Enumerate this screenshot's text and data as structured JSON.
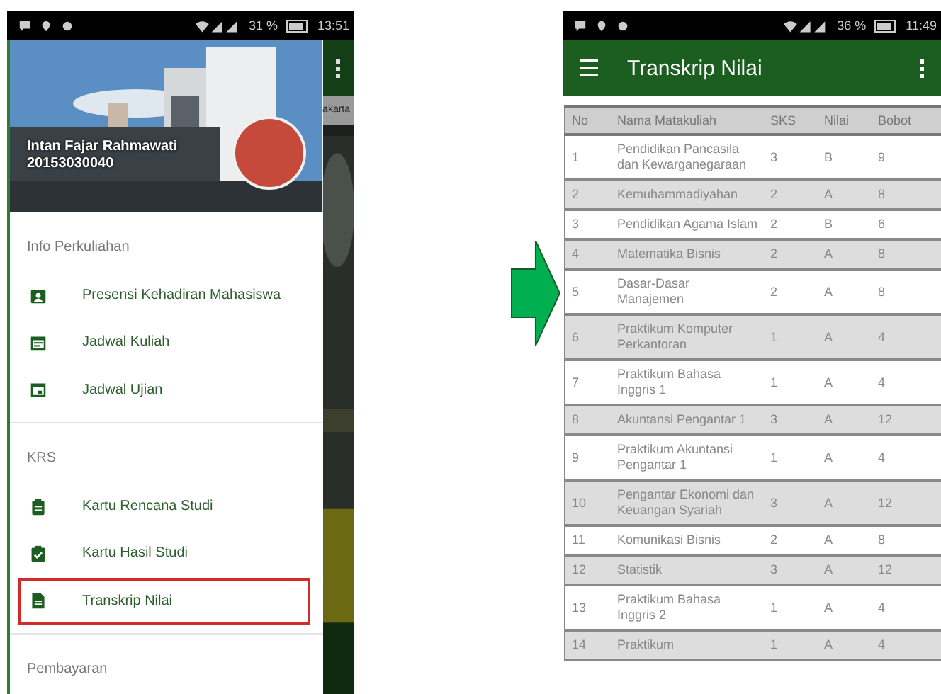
{
  "left_phone": {
    "status_bar": {
      "battery": "31 %",
      "time": "13:51"
    },
    "profile": {
      "name": "Intan Fajar Rahmawati",
      "student_id": "20153030040"
    },
    "background_app": {
      "text": "akarta"
    },
    "drawer_sections": [
      {
        "header": "Info Perkuliahan",
        "items": [
          {
            "label": "Presensi Kehadiran Mahasiswa",
            "kind": "person",
            "selected": false
          },
          {
            "label": "Jadwal Kuliah",
            "kind": "calendar-list",
            "selected": false
          },
          {
            "label": "Jadwal Ujian",
            "kind": "calendar",
            "selected": false
          }
        ]
      },
      {
        "header": "KRS",
        "items": [
          {
            "label": "Kartu Rencana Studi",
            "kind": "clipboard",
            "selected": false
          },
          {
            "label": "Kartu Hasil Studi",
            "kind": "clipboard-check",
            "selected": false
          },
          {
            "label": "Transkrip Nilai",
            "kind": "document",
            "selected": true
          }
        ]
      },
      {
        "header": "Pembayaran"
      }
    ]
  },
  "right_phone": {
    "status_bar": {
      "battery": "36 %",
      "time": "11:49"
    },
    "app_bar": {
      "title": "Transkrip Nilai"
    },
    "table": {
      "columns": [
        "No",
        "Nama Matakuliah",
        "SKS",
        "Nilai",
        "Bobot"
      ],
      "rows": [
        [
          "1",
          "Pendidikan Pancasila dan Kewarganegaraan",
          "3",
          "B",
          "9"
        ],
        [
          "2",
          "Kemuhammadiyahan",
          "2",
          "A",
          "8"
        ],
        [
          "3",
          "Pendidikan Agama Islam",
          "2",
          "B",
          "6"
        ],
        [
          "4",
          "Matematika Bisnis",
          "2",
          "A",
          "8"
        ],
        [
          "5",
          "Dasar-Dasar Manajemen",
          "2",
          "A",
          "8"
        ],
        [
          "6",
          "Praktikum Komputer Perkantoran",
          "1",
          "A",
          "4"
        ],
        [
          "7",
          "Praktikum Bahasa Inggris 1",
          "1",
          "A",
          "4"
        ],
        [
          "8",
          "Akuntansi Pengantar 1",
          "3",
          "A",
          "12"
        ],
        [
          "9",
          "Praktikum Akuntansi Pengantar 1",
          "1",
          "A",
          "4"
        ],
        [
          "10",
          "Pengantar Ekonomi dan Keuangan Syariah",
          "3",
          "A",
          "12"
        ],
        [
          "11",
          "Komunikasi Bisnis",
          "2",
          "A",
          "8"
        ],
        [
          "12",
          "Statistik",
          "3",
          "A",
          "12"
        ],
        [
          "13",
          "Praktikum Bahasa Inggris 2",
          "1",
          "A",
          "4"
        ],
        [
          "14",
          "Praktikum",
          "1",
          "A",
          "4"
        ]
      ]
    }
  }
}
